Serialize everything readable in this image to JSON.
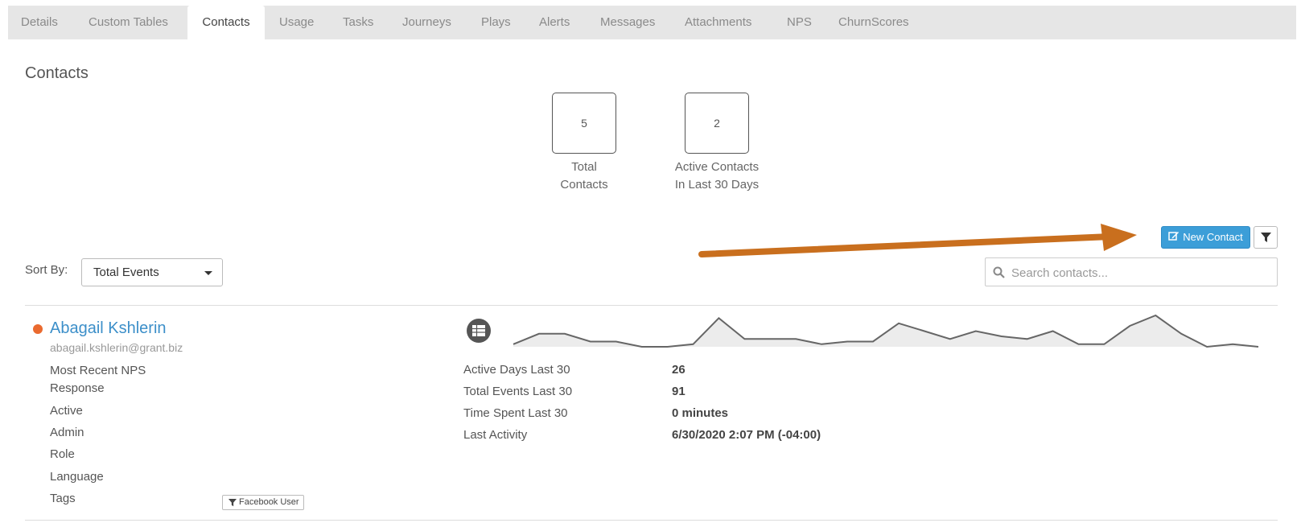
{
  "tabs": [
    {
      "label": "Details"
    },
    {
      "label": "Custom Tables"
    },
    {
      "label": "Contacts"
    },
    {
      "label": "Usage"
    },
    {
      "label": "Tasks"
    },
    {
      "label": "Journeys"
    },
    {
      "label": "Plays"
    },
    {
      "label": "Alerts"
    },
    {
      "label": "Messages"
    },
    {
      "label": "Attachments"
    },
    {
      "label": "NPS"
    },
    {
      "label": "ChurnScores"
    }
  ],
  "active_tab": "Contacts",
  "section_title": "Contacts",
  "stats": [
    {
      "value": "5",
      "label_line1": "Total",
      "label_line2": "Contacts"
    },
    {
      "value": "2",
      "label_line1": "Active Contacts",
      "label_line2": "In Last 30 Days"
    }
  ],
  "toolbar": {
    "new_contact_label": "New Contact",
    "new_contact_icon": "edit-icon",
    "filter_icon": "filter-icon"
  },
  "sort": {
    "label": "Sort By:",
    "selected": "Total Events"
  },
  "search": {
    "placeholder": "Search contacts...",
    "value": ""
  },
  "colors": {
    "accent": "#3c9ed8",
    "link": "#3c8fc9",
    "status_dot": "#ea6a2f",
    "annotation_arrow": "#c96f1e",
    "tabbar_bg": "#e6e6e6"
  },
  "contact": {
    "name": "Abagail Kshlerin",
    "email": "abagail.kshlerin@grant.biz",
    "fields": [
      {
        "label_line1": "Most Recent NPS",
        "label_line2": "Response"
      },
      {
        "label": "Active"
      },
      {
        "label": "Admin"
      },
      {
        "label": "Role"
      },
      {
        "label": "Language"
      },
      {
        "label": "Tags"
      }
    ],
    "tag": "Facebook User",
    "metrics": [
      {
        "label": "Active Days Last 30",
        "value": "26"
      },
      {
        "label": "Total Events Last 30",
        "value": "91"
      },
      {
        "label": "Time Spent Last 30",
        "value": "0 minutes"
      },
      {
        "label": "Last Activity",
        "value": "6/30/2020 2:07 PM (-04:00)"
      }
    ],
    "sparkline": [
      1,
      5,
      5,
      2,
      2,
      0,
      0,
      1,
      11,
      3,
      3,
      3,
      1,
      2,
      2,
      9,
      6,
      3,
      6,
      4,
      3,
      6,
      1,
      1,
      8,
      12,
      5,
      0,
      1,
      0
    ]
  }
}
